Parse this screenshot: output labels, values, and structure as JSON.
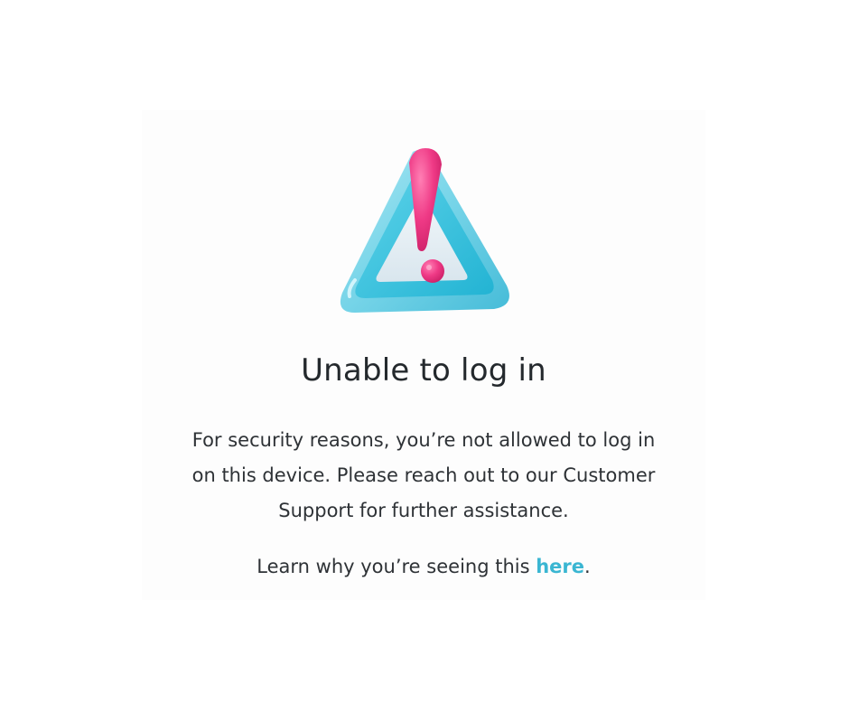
{
  "dialog": {
    "title": "Unable to log in",
    "message": "For security reasons, you’re not allowed to log in on this device. Please reach out to our Customer Support for further assistance.",
    "learn_prefix": "Learn why you’re seeing this ",
    "link_label": "here",
    "learn_suffix": "."
  },
  "illustration": {
    "icon": "warning-triangle-icon",
    "triangle_color": "#3cc4dd",
    "exclamation_color": "#ec2f7c"
  },
  "colors": {
    "text": "#2e3236",
    "title": "#24292d",
    "link": "#3ab6d2"
  }
}
